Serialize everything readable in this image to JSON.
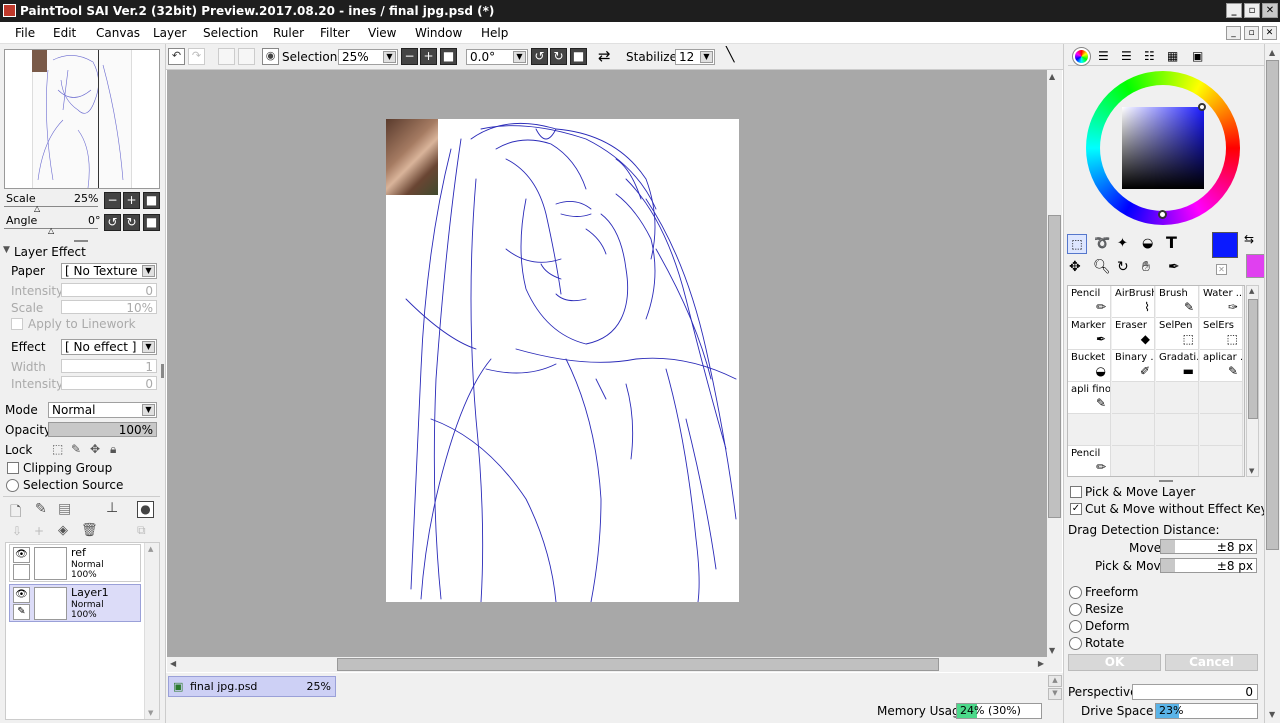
{
  "window": {
    "title": "PaintTool SAI Ver.2 (32bit) Preview.2017.08.20 - ines / final jpg.psd (*)"
  },
  "menu": [
    "File",
    "Edit",
    "Canvas",
    "Layer",
    "Selection",
    "Ruler",
    "Filter",
    "View",
    "Window",
    "Help"
  ],
  "navigator": {
    "scale_label": "Scale",
    "scale_value": "25%",
    "angle_label": "Angle",
    "angle_value": "0°"
  },
  "layer_effect": {
    "section_title": "Layer Effect",
    "paper_label": "Paper",
    "paper_value": "[ No Texture ]",
    "intensity_label": "Intensity",
    "intensity_value": "0",
    "scale_label": "Scale",
    "scale_value": "10%",
    "apply_linework_label": "Apply to Linework",
    "effect_label": "Effect",
    "effect_value": "[ No effect ]",
    "width_label": "Width",
    "width_value": "1",
    "intensity2_label": "Intensity",
    "intensity2_value": "0"
  },
  "layer_props": {
    "mode_label": "Mode",
    "mode_value": "Normal",
    "opacity_label": "Opacity",
    "opacity_value": "100%",
    "opacity_level": 100,
    "lock_label": "Lock",
    "clipping_group_label": "Clipping Group",
    "selection_source_label": "Selection Source"
  },
  "layers": [
    {
      "name": "ref",
      "mode": "Normal",
      "opacity": "100%",
      "selected": false
    },
    {
      "name": "Layer1",
      "mode": "Normal",
      "opacity": "100%",
      "selected": true
    }
  ],
  "toolbar": {
    "selection_label": "Selection",
    "zoom_value": "25%",
    "rotation_value": "0.0°",
    "stabilizer_label": "Stabilizer",
    "stabilizer_value": "12"
  },
  "document_tab": {
    "name": "final jpg.psd",
    "zoom": "25%"
  },
  "colors": {
    "primary": "#0a1aff",
    "secondary": "#e040f0",
    "sketch_stroke": "#2a2ab8"
  },
  "tools": [
    {
      "name": "Pencil",
      "icon": "pencil-icon"
    },
    {
      "name": "AirBrush",
      "icon": "airbrush-icon"
    },
    {
      "name": "Brush",
      "icon": "brush-icon"
    },
    {
      "name": "Water ...",
      "icon": "water-icon"
    },
    {
      "name": "Marker",
      "icon": "marker-icon"
    },
    {
      "name": "Eraser",
      "icon": "eraser-icon"
    },
    {
      "name": "SelPen",
      "icon": "selpen-icon"
    },
    {
      "name": "SelErs",
      "icon": "selers-icon"
    },
    {
      "name": "Bucket",
      "icon": "bucket-icon"
    },
    {
      "name": "Binary ...",
      "icon": "binary-icon"
    },
    {
      "name": "Gradati...",
      "icon": "gradation-icon"
    },
    {
      "name": "aplicar ...",
      "icon": "aplicar-icon"
    },
    {
      "name": "apli fino",
      "icon": "aplifino-icon"
    },
    {
      "name": "",
      "icon": ""
    },
    {
      "name": "",
      "icon": ""
    },
    {
      "name": "",
      "icon": ""
    },
    {
      "name": "",
      "icon": ""
    },
    {
      "name": "",
      "icon": ""
    },
    {
      "name": "",
      "icon": ""
    },
    {
      "name": "",
      "icon": ""
    },
    {
      "name": "Pencil",
      "icon": "pencil-icon"
    },
    {
      "name": "",
      "icon": ""
    },
    {
      "name": "",
      "icon": ""
    },
    {
      "name": "",
      "icon": ""
    }
  ],
  "move_options": {
    "pick_move_layer_label": "Pick & Move Layer",
    "pick_move_layer_checked": false,
    "cut_move_label": "Cut & Move without Effect Key",
    "cut_move_checked": true,
    "drag_detection_label": "Drag Detection Distance:",
    "move_label": "Move",
    "move_value": "±8 px",
    "pick_move_label": "Pick & Move",
    "pick_move_value": "±8 px"
  },
  "transform_options": [
    "Freeform",
    "Resize",
    "Deform",
    "Rotate"
  ],
  "buttons": {
    "ok": "OK",
    "cancel": "Cancel"
  },
  "perspective": {
    "label": "Perspective",
    "value": "0"
  },
  "status": {
    "memory_label": "Memory Usage",
    "memory_value": "24% (30%)",
    "memory_level": 24,
    "drive_label": "Drive Space",
    "drive_value": "23%",
    "drive_level": 23
  }
}
